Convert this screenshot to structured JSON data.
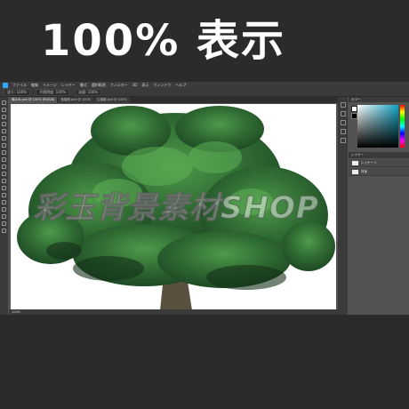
{
  "headline": {
    "text": "100% 表示"
  },
  "menu": {
    "items": [
      "ファイル",
      "編集",
      "イメージ",
      "レイヤー",
      "書式",
      "選択範囲",
      "フィルター",
      "3D",
      "表示",
      "ウィンドウ",
      "ヘルプ"
    ]
  },
  "options": {
    "items": [
      "塗り: 100%",
      "不透明度: 100%",
      "流量: 100%"
    ]
  },
  "tabs": [
    {
      "label": "緑の木.psd @ 100% (RGB/8)",
      "active": true
    },
    {
      "label": "落葉樹.psd @ 100%",
      "active": false
    },
    {
      "label": "広葉樹.psd @ 100%",
      "active": false
    }
  ],
  "status": {
    "text": "100%"
  },
  "panels": {
    "color_label": "カラー",
    "layers_label": "レイヤー",
    "layers": [
      "レイヤー 1",
      "背景"
    ]
  },
  "watermark": {
    "text": "彩玉背景素材SHOP"
  },
  "colors": {
    "background": "#2b2b2b",
    "workspace": "#535353",
    "panel_dark": "#3a3a3a",
    "tree_dark": "#1f4a25",
    "tree_mid": "#2f6b33",
    "tree_light": "#4f9a4a",
    "trunk": "#5a5040"
  },
  "icons": [
    "photoshop-logo-icon",
    "move-tool-icon",
    "marquee-tool-icon",
    "lasso-tool-icon",
    "brush-tool-icon",
    "eraser-tool-icon",
    "zoom-tool-icon"
  ]
}
